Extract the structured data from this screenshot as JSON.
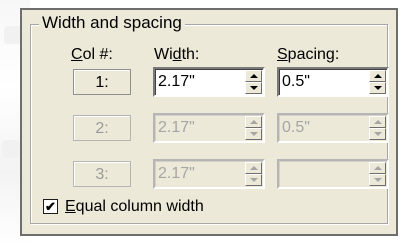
{
  "group": {
    "title": "Width and spacing"
  },
  "headers": {
    "col_num": "Col #:",
    "width": "Width:",
    "spacing": "Spacing:"
  },
  "rows": [
    {
      "col": "1:",
      "width": "2.17\"",
      "spacing": "0.5\"",
      "enabled": true
    },
    {
      "col": "2:",
      "width": "2.17\"",
      "spacing": "0.5\"",
      "enabled": false
    },
    {
      "col": "3:",
      "width": "2.17\"",
      "spacing": "",
      "enabled": false
    }
  ],
  "equal_width": {
    "label": "Equal column width",
    "checked": true,
    "check_glyph": "✔"
  }
}
